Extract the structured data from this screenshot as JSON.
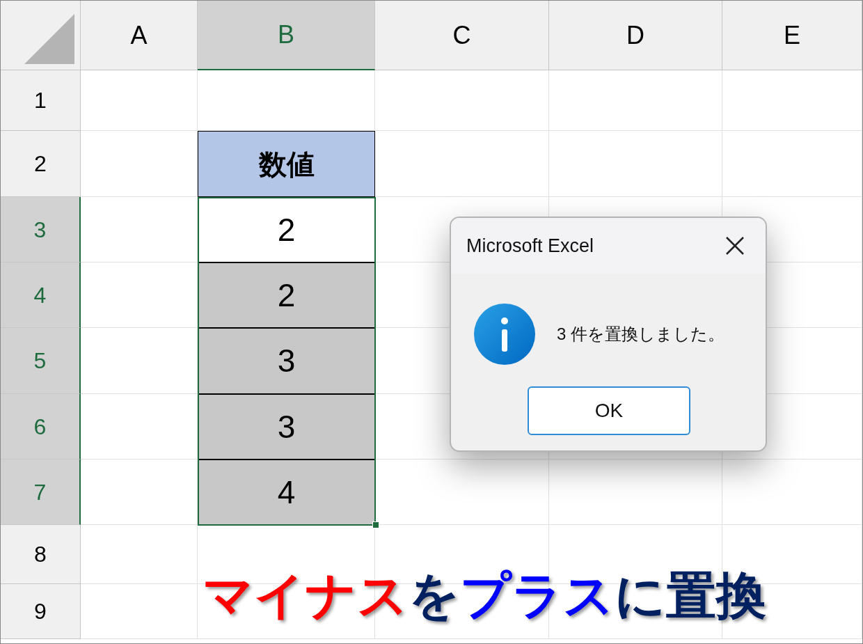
{
  "sheet": {
    "columns": [
      {
        "label": "A",
        "selected": false
      },
      {
        "label": "B",
        "selected": true
      },
      {
        "label": "C",
        "selected": false
      },
      {
        "label": "D",
        "selected": false
      },
      {
        "label": "E",
        "selected": false
      }
    ],
    "rows": [
      {
        "label": "1",
        "selected": false
      },
      {
        "label": "2",
        "selected": false
      },
      {
        "label": "3",
        "selected": true
      },
      {
        "label": "4",
        "selected": true
      },
      {
        "label": "5",
        "selected": true
      },
      {
        "label": "6",
        "selected": true
      },
      {
        "label": "7",
        "selected": true
      },
      {
        "label": "8",
        "selected": false
      },
      {
        "label": "9",
        "selected": false
      }
    ],
    "table": {
      "header": "数値",
      "values": [
        {
          "text": "2",
          "active": true
        },
        {
          "text": "2",
          "active": false
        },
        {
          "text": "3",
          "active": false
        },
        {
          "text": "3",
          "active": false
        },
        {
          "text": "4",
          "active": false
        }
      ]
    }
  },
  "dialog": {
    "title": "Microsoft Excel",
    "message": "3 件を置換しました。",
    "button": "OK"
  },
  "caption": [
    {
      "text": "マイナス",
      "color": "#ff0000"
    },
    {
      "text": "を",
      "color": "#002060"
    },
    {
      "text": "プラス",
      "color": "#0000ff"
    },
    {
      "text": "に置換",
      "color": "#002060"
    }
  ]
}
